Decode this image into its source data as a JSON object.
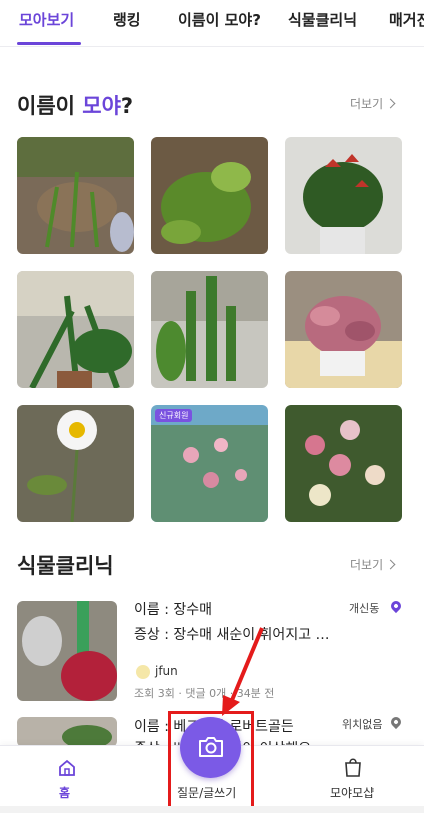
{
  "tabs": [
    {
      "label": "모아보기",
      "active": true
    },
    {
      "label": "랭킹"
    },
    {
      "label": "이름이 모야?"
    },
    {
      "label": "식물클리닉"
    },
    {
      "label": "매거진"
    }
  ],
  "name_section": {
    "title_prefix": "이름이 ",
    "title_accent": "모야",
    "title_suffix": "?",
    "more": "더보기"
  },
  "grid_badge": "신규회원",
  "clinic_section": {
    "title": "식물클리닉",
    "more": "더보기",
    "items": [
      {
        "name": "이름 : 장수매",
        "symptom": "증상 : 장수매 새순이 휘어지고 …",
        "location": "개신동",
        "user": "jfun",
        "stats": "조회 3회 · 댓글 0개 · 34분 전"
      },
      {
        "name": "이름 : 베고니아 로버트골든",
        "symptom": "증상 : 베고니아 잎이 이상해요",
        "location": "위치없음"
      }
    ]
  },
  "bottom_nav": {
    "home": "홈",
    "write": "질문/글쓰기",
    "mine": "모야모샵"
  },
  "colors": {
    "accent": "#6b45d9",
    "annotation": "#e41b1b"
  }
}
